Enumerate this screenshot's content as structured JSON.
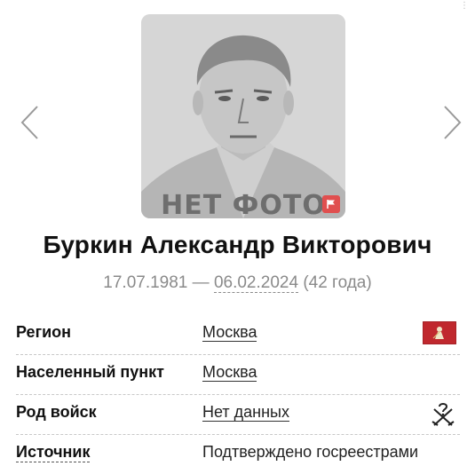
{
  "photo": {
    "placeholder_text": "НЕТ ФОТО"
  },
  "person": {
    "name": "Буркин Александр Викторович",
    "birth_date": "17.07.1981",
    "dash": "—",
    "death_date": "06.02.2024",
    "age": "(42 года)"
  },
  "info": {
    "region": {
      "label": "Регион",
      "value": "Москва"
    },
    "locality": {
      "label": "Населенный пункт",
      "value": "Москва"
    },
    "branch": {
      "label": "Род войск",
      "value": "Нет данных"
    },
    "source": {
      "label": "Источник",
      "value": "Подтверждено госреестрами"
    }
  },
  "colors": {
    "flag_button": "#e04f4f",
    "moscow_flag": "#c0282e"
  },
  "icons": {
    "prev": "chevron-left-icon",
    "next": "chevron-right-icon",
    "flag": "flag-icon",
    "region_emblem": "moscow-flag-icon",
    "branch_unknown": "crossed-swords-question-icon"
  }
}
